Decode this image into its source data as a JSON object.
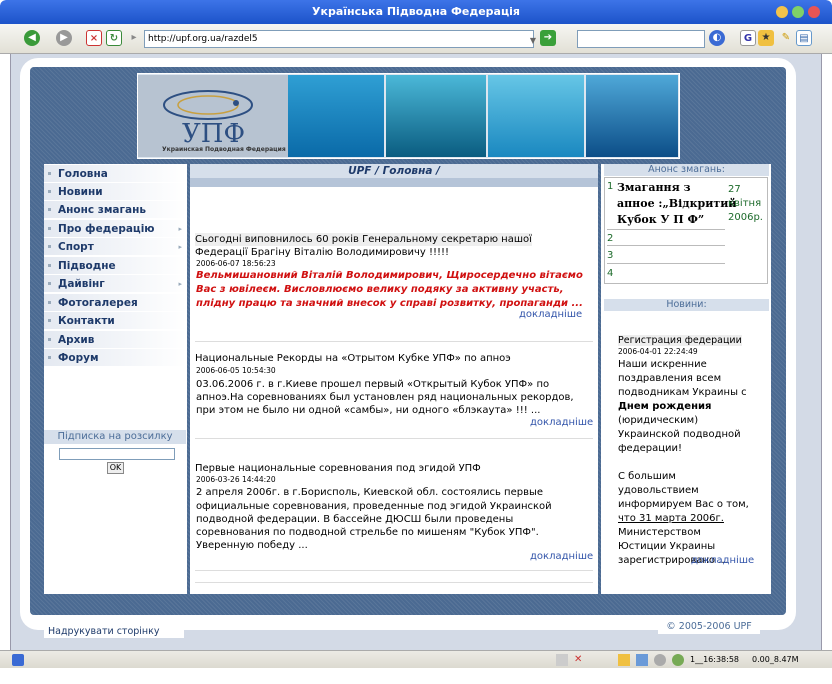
{
  "window": {
    "title": "Українська Підводна Федерація"
  },
  "toolbar": {
    "url": "http://upf.org.ua/razdel5"
  },
  "banner": {
    "logo_text": "УПФ",
    "logo_subtext": "Украинская Подводная Федерация"
  },
  "nav": [
    {
      "label": "Головна"
    },
    {
      "label": "Новини"
    },
    {
      "label": "Анонс змагань"
    },
    {
      "label": "Про федерацію"
    },
    {
      "label": "Спорт"
    },
    {
      "label": "Підводне полювання"
    },
    {
      "label": "Дайвінг"
    },
    {
      "label": "Фотогалерея"
    },
    {
      "label": "Контакти"
    },
    {
      "label": "Архив"
    },
    {
      "label": "Форум"
    }
  ],
  "subscribe": {
    "title": "Підписка на розсилку",
    "ok": "OK"
  },
  "breadcrumb": "UPF / Головна /",
  "news": [
    {
      "title1": "Сьогодні виповнилось 60 років Генеральному секретарю нашої",
      "title2": "Федерації Брагіну Віталію Володимировичу !!!!!",
      "date": "2006-06-07 18:56:23",
      "lines": [
        "Вельмишановний Віталій Володимирович, Щиросердечно вітаємо",
        "Вас з ювілеєм. Висловлюємо велику подяку за активну участь,",
        "плідну працю та значний внесок у справі розвитку, пропаганди ..."
      ],
      "more": "докладніше"
    },
    {
      "title1": "Национальные Рекорды на «Отрытом Кубке УПФ» по апноэ",
      "date": "2006-06-05 10:54:30",
      "lines": [
        "03.06.2006 г. в г.Киеве прошел первый «Открытый Кубок УПФ» по",
        "апноэ.На соревнованиях был установлен ряд национальных рекордов,",
        "при этом не было ни одной «самбы», ни одного «блэкаута» !!!  ..."
      ],
      "more": "докладніше"
    },
    {
      "title1": "Первые национальные соревнования под эгидой УПФ",
      "date": "2006-03-26 14:44:20",
      "lines": [
        "2 апреля 2006г. в г.Борисполь, Киевской обл. состоялись первые",
        "официальные соревнования, проведенные под эгидой Украинской",
        "подводной федерации. В бассейне ДЮСШ были проведены",
        "соревнования по подводной стрельбе по мишеням \"Кубок УПФ\".",
        "Уверенную победу ..."
      ],
      "more": "докладніше"
    }
  ],
  "announce": {
    "title": "Анонс змагань:",
    "event_num": "1",
    "event_text": [
      "Змагання з",
      "апное :„Відкритий",
      "Кубок У П Ф”"
    ],
    "event_date": [
      "27",
      "квітня",
      "2006р."
    ],
    "rows": [
      "2",
      "3",
      "4"
    ]
  },
  "rnews": {
    "title": "Новини:",
    "item_title": "Регистрация федерации",
    "date": "2006-04-01 22:24:49",
    "lines": [
      "Наши искренние",
      "поздравления всем",
      "подводникам Украины с",
      "Днем рождения",
      "(юридическим)",
      "Украинской подводной",
      "федерации!",
      "",
      "С большим",
      "удовольствием",
      "информируем Вас о том,",
      "что 31 марта 2006г.",
      "Министерством",
      "Юстиции Украины",
      "зарегистрировано ..."
    ],
    "more": "докладніше"
  },
  "footer": {
    "print": "Надрукувати сторінку",
    "copyright": "© 2005-2006 UPF"
  },
  "status": {
    "time": "1__16:38:58",
    "info": "0.00_8.47M"
  }
}
